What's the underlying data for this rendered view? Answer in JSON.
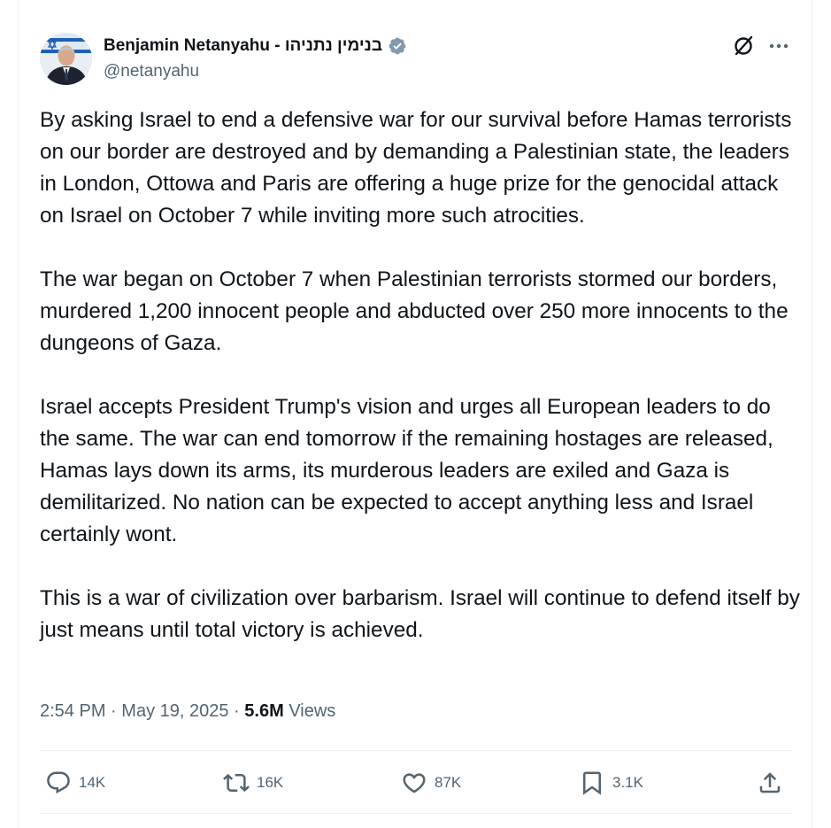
{
  "author": {
    "display_name": "Benjamin Netanyahu - בנימין נתניהו",
    "handle": "@netanyahu",
    "verified_badge": "verified-badge-icon",
    "avatar": "profile-photo"
  },
  "header_icons": [
    "grok-icon",
    "more-icon"
  ],
  "tweet": {
    "paragraphs": [
      "By asking Israel to end a defensive war for our survival before Hamas terrorists on our border are destroyed and by demanding a Palestinian state, the leaders in London, Ottowa and Paris are offering a huge prize for the genocidal attack on Israel on October 7 while inviting more such atrocities.",
      "The war began on October 7 when Palestinian terrorists stormed our borders, murdered 1,200 innocent people and abducted over 250 more innocents to the dungeons of Gaza.",
      "Israel accepts President Trump's vision and urges all European leaders to do the same. The war can end tomorrow if the remaining hostages are released, Hamas lays down its arms, its murderous leaders are exiled and Gaza is demilitarized. No nation can be expected to accept anything less and Israel certainly wont.",
      "This is a war of civilization over barbarism. Israel will continue to defend itself by just means until total victory is achieved."
    ]
  },
  "meta": {
    "time": "2:54 PM",
    "separator": "·",
    "date": "May 19, 2025",
    "views_count": "5.6M",
    "views_label": "Views"
  },
  "actions": {
    "replies": "14K",
    "reposts": "16K",
    "likes": "87K",
    "bookmarks": "3.1K"
  },
  "colors": {
    "text": "#0f1419",
    "secondary": "#536471",
    "border": "#eff3f4",
    "badge": "#829aab"
  }
}
